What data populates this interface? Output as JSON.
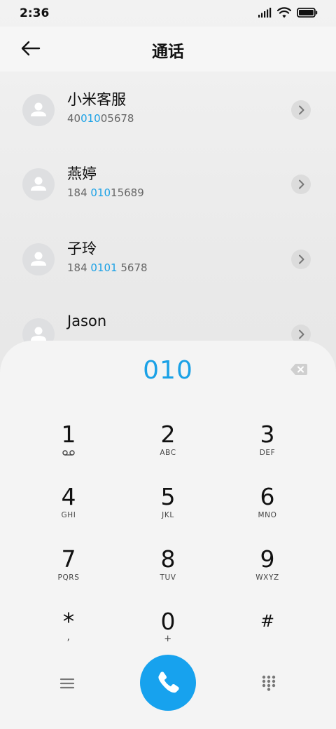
{
  "status_bar": {
    "time": "2:36"
  },
  "header": {
    "title": "通话"
  },
  "contacts": [
    {
      "name": "小米客服",
      "number_pre": "40",
      "number_match": "010",
      "number_post": "05678"
    },
    {
      "name": "燕婷",
      "number_pre": "184 ",
      "number_match": "010",
      "number_post": "15689"
    },
    {
      "name": "子玲",
      "number_pre": "184 ",
      "number_match": "0101",
      "number_post": " 5678"
    },
    {
      "name": "Jason"
    }
  ],
  "dialer": {
    "input": "010",
    "keys": [
      {
        "digit": "1",
        "sub": ""
      },
      {
        "digit": "2",
        "sub": "ABC"
      },
      {
        "digit": "3",
        "sub": "DEF"
      },
      {
        "digit": "4",
        "sub": "GHI"
      },
      {
        "digit": "5",
        "sub": "JKL"
      },
      {
        "digit": "6",
        "sub": "MNO"
      },
      {
        "digit": "7",
        "sub": "PQRS"
      },
      {
        "digit": "8",
        "sub": "TUV"
      },
      {
        "digit": "9",
        "sub": "WXYZ"
      },
      {
        "digit": "*",
        "sub": ","
      },
      {
        "digit": "0",
        "sub": "+"
      },
      {
        "digit": "#",
        "sub": ""
      }
    ]
  },
  "icons": {
    "back": "arrow-left-icon",
    "voicemail": "voicemail-icon",
    "backspace": "backspace-icon",
    "menu": "menu-icon",
    "call": "phone-icon",
    "keypad": "keypad-icon",
    "chevron": "chevron-right-icon",
    "avatar": "person-icon"
  },
  "colors": {
    "accent": "#1aa1e6",
    "call_button": "#17a2ee"
  }
}
